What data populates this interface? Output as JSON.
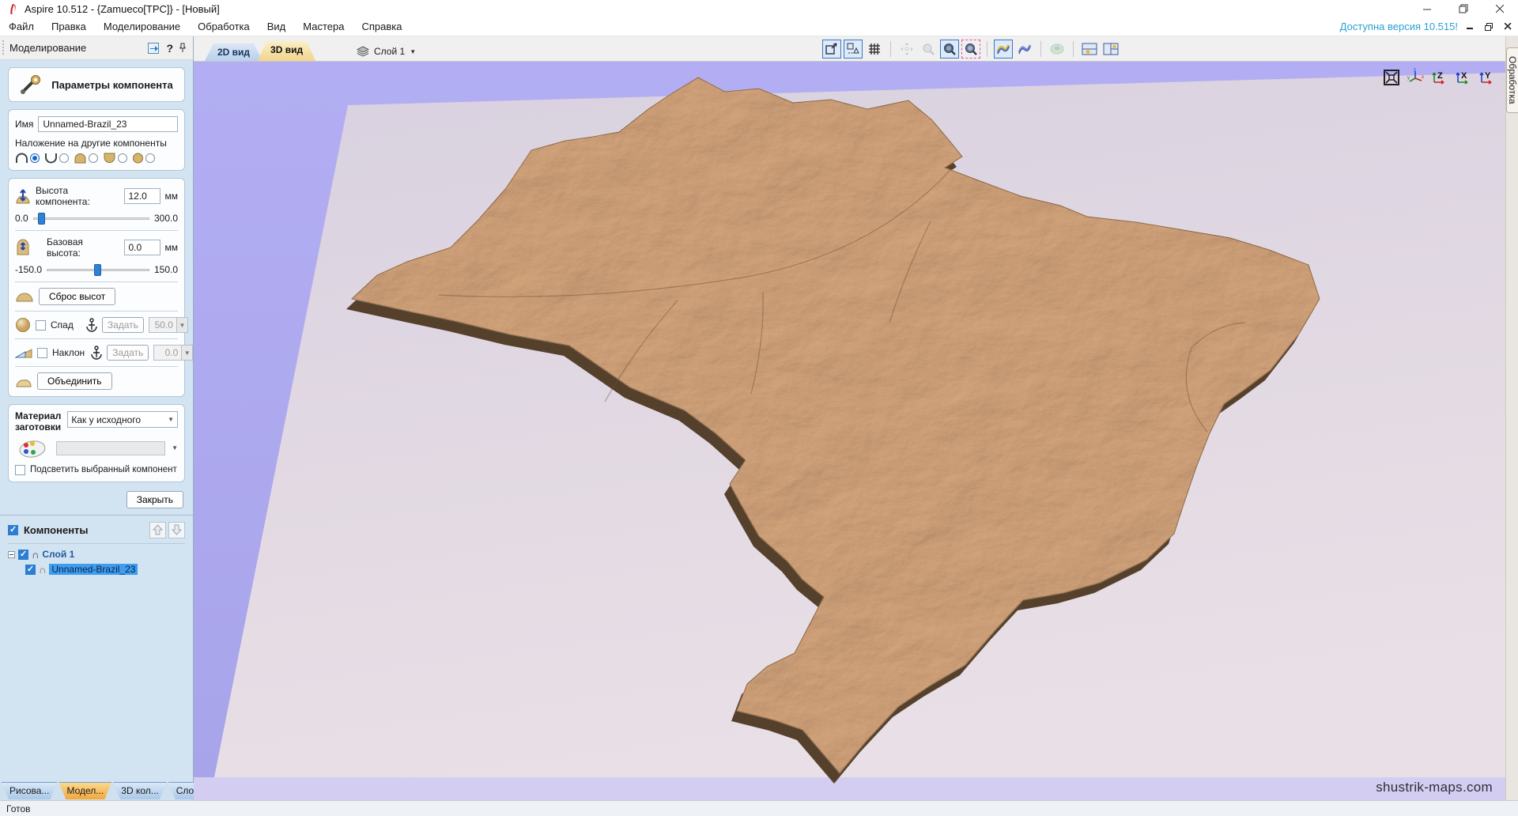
{
  "window": {
    "app_title": "Aspire 10.512 - {Zamueco[TPC]} - [Новый]",
    "update_notice": "Доступна версия 10.515!"
  },
  "menu": {
    "items": [
      "Файл",
      "Правка",
      "Моделирование",
      "Обработка",
      "Вид",
      "Мастера",
      "Справка"
    ]
  },
  "left_panel": {
    "header": "Моделирование",
    "component_params": {
      "title": "Параметры компонента",
      "name_label": "Имя",
      "name_value": "Unnamed-Brazil_23",
      "combine_label": "Наложение на другие компоненты",
      "combine_modes": [
        "add",
        "subtract",
        "merge-high",
        "merge-low",
        "multiply"
      ],
      "height_label": "Высота компонента:",
      "height_value": "12.0",
      "height_unit": "мм",
      "height_min": "0.0",
      "height_max": "300.0",
      "base_label": "Базовая высота:",
      "base_value": "0.0",
      "base_unit": "мм",
      "base_min": "-150.0",
      "base_max": "150.0",
      "reset_heights_button": "Сброс высот",
      "fade_label": "Спад",
      "fade_set_label": "Задать",
      "fade_value": "50.0",
      "fade_unit": "%",
      "tilt_label": "Наклон",
      "tilt_set_label": "Задать",
      "tilt_value": "0.0",
      "tilt_unit": "°",
      "combine_button": "Объединить",
      "material_label_1": "Материал",
      "material_label_2": "заготовки",
      "material_value": "Как у исходного",
      "highlight_label": "Подсветить выбранный компонент",
      "close_button": "Закрыть"
    },
    "components": {
      "title": "Компоненты",
      "layer_name": "Слой 1",
      "component_name": "Unnamed-Brazil_23"
    },
    "bottom_tabs": [
      {
        "label": "Рисова...",
        "active": false
      },
      {
        "label": "Модел...",
        "active": true
      },
      {
        "label": "3D кол...",
        "active": false
      },
      {
        "label": "Слои",
        "active": false
      }
    ]
  },
  "workarea": {
    "view_tabs": [
      {
        "label": "2D вид",
        "active": false
      },
      {
        "label": "3D вид",
        "active": true
      }
    ],
    "layer_selector": "Слой 1",
    "toolbar_icons": [
      "zoom-extents",
      "zoom-to-drawing",
      "toggle-grid",
      "pan-view",
      "zoom-tool",
      "zoom-window",
      "zoom-selected",
      "shaded-components",
      "component-outlines",
      "preview-model",
      "layout-2d3d",
      "layout-multi"
    ],
    "view_controls": [
      "fit-view",
      "iso-view",
      "z-axis-view",
      "x-axis-view",
      "y-axis-view"
    ],
    "axis_letters": {
      "z": "Z",
      "x": "X",
      "y": "Y"
    },
    "watermark": "shustrik-maps.com"
  },
  "right_bar": {
    "tab_label": "Обработка"
  },
  "statusbar": {
    "text": "Готов"
  },
  "colors": {
    "viewport_bg": "#aeaaf0",
    "plane": "#ddd6e2",
    "terrain": "#dcb89c",
    "terrain_shadow": "#55402c",
    "accent_blue": "#2d7dd2",
    "active_tab": "#f2d48c",
    "selection": "#3f9df0",
    "update_link": "#2a9fd8"
  }
}
